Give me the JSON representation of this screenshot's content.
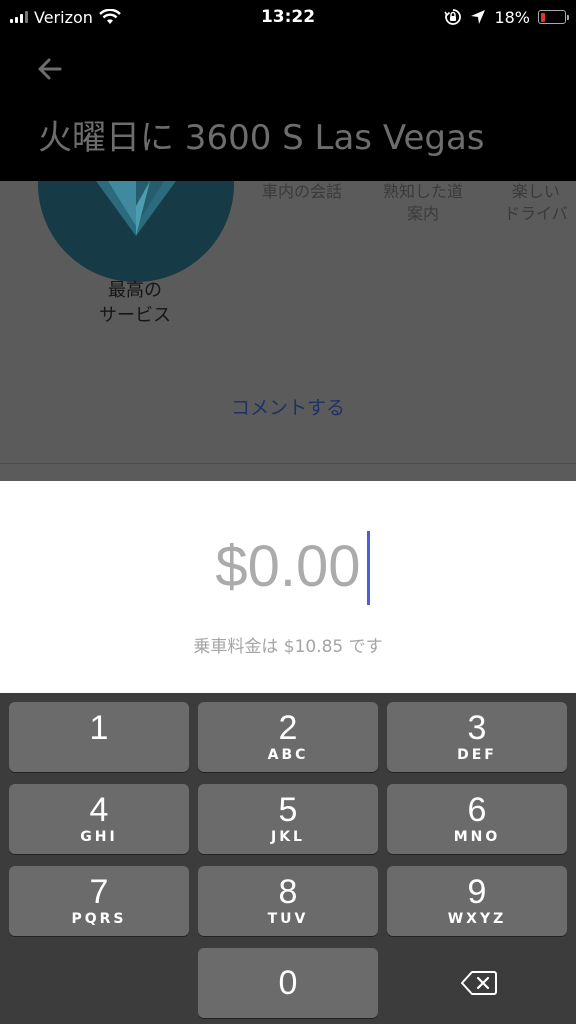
{
  "status_bar": {
    "carrier": "Verizon",
    "time": "13:22",
    "battery_percent": "18%",
    "battery_level": 0.18,
    "icons": [
      "signal-icon",
      "wifi-icon",
      "orientation-lock-icon",
      "location-arrow-icon",
      "battery-icon"
    ]
  },
  "header": {
    "back_icon": "back-arrow-icon",
    "title": "火曜日に 3600 S Las Vegas"
  },
  "feedback": {
    "badge_label": "最高の\nサービス",
    "tags": [
      "車内の会話",
      "熟知した道\n案内",
      "楽しい\nドライバ"
    ],
    "comment_link": "コメントする"
  },
  "tip": {
    "amount": "$0.00",
    "fare_note": "乗車料金は $10.85 です"
  },
  "keypad": {
    "keys": [
      {
        "num": "1",
        "letters": ""
      },
      {
        "num": "2",
        "letters": "ABC"
      },
      {
        "num": "3",
        "letters": "DEF"
      },
      {
        "num": "4",
        "letters": "GHI"
      },
      {
        "num": "5",
        "letters": "JKL"
      },
      {
        "num": "6",
        "letters": "MNO"
      },
      {
        "num": "7",
        "letters": "PQRS"
      },
      {
        "num": "8",
        "letters": "TUV"
      },
      {
        "num": "9",
        "letters": "WXYZ"
      },
      {
        "num": "0",
        "letters": ""
      }
    ],
    "delete_icon": "backspace-icon"
  },
  "colors": {
    "header_bg": "#000000",
    "overlay_bg": "#5b5b5b",
    "cursor": "#4a5fe0",
    "key_bg": "#6b6b6b",
    "keyboard_bg": "#3c3c3c",
    "battery_low": "#e3342f"
  }
}
